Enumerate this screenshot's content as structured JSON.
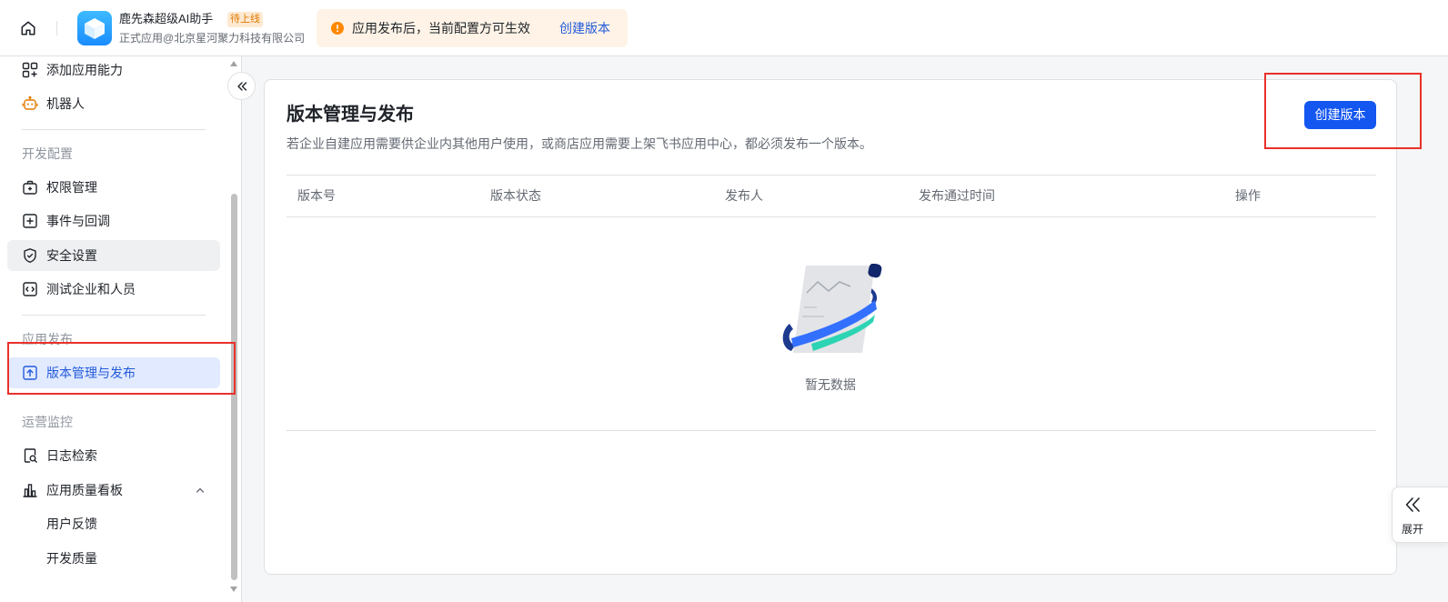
{
  "header": {
    "home_icon": "home-icon",
    "logo_icon": "cube-icon",
    "app_name": "鹿先森超级AI助手",
    "status_badge": "待上线",
    "app_subtitle": "正式应用@北京星河聚力科技有限公司",
    "notice": {
      "icon": "warning-icon",
      "text": "应用发布后，当前配置方可生效",
      "link": "创建版本"
    }
  },
  "sidebar": {
    "collapse_icon": "double-chevron-left-icon",
    "items": [
      {
        "label": "添加应用能力",
        "icon": "grid-plus-icon"
      },
      {
        "label": "机器人",
        "icon": "robot-icon"
      }
    ],
    "sections": [
      {
        "title": "开发配置",
        "items": [
          {
            "label": "权限管理",
            "icon": "briefcase-icon"
          },
          {
            "label": "事件与回调",
            "icon": "event-icon"
          },
          {
            "label": "安全设置",
            "icon": "shield-check-icon",
            "highlighted": true
          },
          {
            "label": "测试企业和人员",
            "icon": "code-icon"
          }
        ]
      },
      {
        "title": "应用发布",
        "items": [
          {
            "label": "版本管理与发布",
            "icon": "upload-icon",
            "selected": true
          }
        ]
      },
      {
        "title": "运营监控",
        "items": [
          {
            "label": "日志检索",
            "icon": "log-search-icon"
          },
          {
            "label": "应用质量看板",
            "icon": "bar-chart-icon",
            "expanded": true,
            "children": [
              {
                "label": "用户反馈"
              },
              {
                "label": "开发质量"
              }
            ]
          }
        ]
      }
    ]
  },
  "main": {
    "title": "版本管理与发布",
    "description": "若企业自建应用需要供企业内其他用户使用，或商店应用需要上架飞书应用中心，都必须发布一个版本。",
    "create_button": "创建版本",
    "table": {
      "columns": [
        "版本号",
        "版本状态",
        "发布人",
        "发布通过时间",
        "操作"
      ],
      "rows": [],
      "empty_text": "暂无数据"
    }
  },
  "side_panel": {
    "icon": "double-chevron-left-icon",
    "label": "展开"
  },
  "colors": {
    "primary": "#1456f0",
    "link": "#245bdb",
    "selected_bg": "#e1eaff",
    "selected_text": "#245bdb",
    "hover_bg": "#eff0f1",
    "warning": "#ff8800",
    "notice_bg": "#fef3e6",
    "badge_bg": "#feead2",
    "badge_text": "#de7802",
    "text": "#1f2329",
    "secondary_text": "#646a73",
    "muted_text": "#8f959e",
    "border": "#dee0e3",
    "page_bg": "#f5f6f7",
    "annotation": "#e8312a"
  }
}
